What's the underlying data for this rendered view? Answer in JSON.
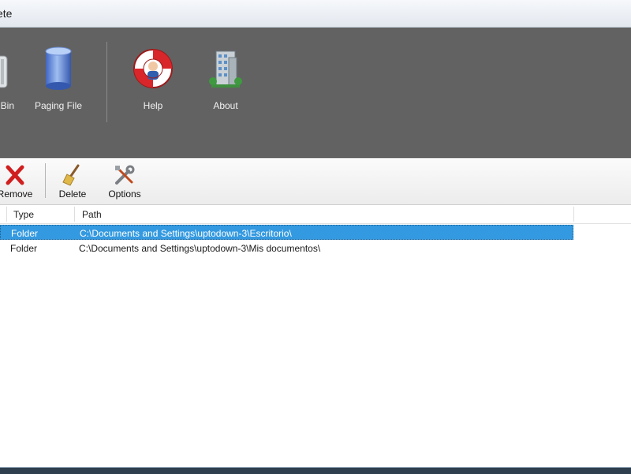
{
  "window": {
    "title_fragment": "ete"
  },
  "ribbon": {
    "items": [
      {
        "label": "Bin",
        "icon": "recycle-bin-icon"
      },
      {
        "label": "Paging File",
        "icon": "paging-file-icon"
      },
      {
        "label": "Help",
        "icon": "lifebuoy-help-icon"
      },
      {
        "label": "About",
        "icon": "building-about-icon"
      }
    ]
  },
  "toolbar": {
    "remove_label": "Remove",
    "delete_label": "Delete",
    "options_label": "Options"
  },
  "list": {
    "columns": [
      "Type",
      "Path"
    ],
    "rows": [
      {
        "type": "Folder",
        "path": "C:\\Documents and Settings\\uptodown-3\\Escritorio\\",
        "selected": true
      },
      {
        "type": "Folder",
        "path": "C:\\Documents and Settings\\uptodown-3\\Mis documentos\\",
        "selected": false
      }
    ]
  },
  "colors": {
    "ribbon_bg": "#626262",
    "selection": "#3399e0"
  }
}
